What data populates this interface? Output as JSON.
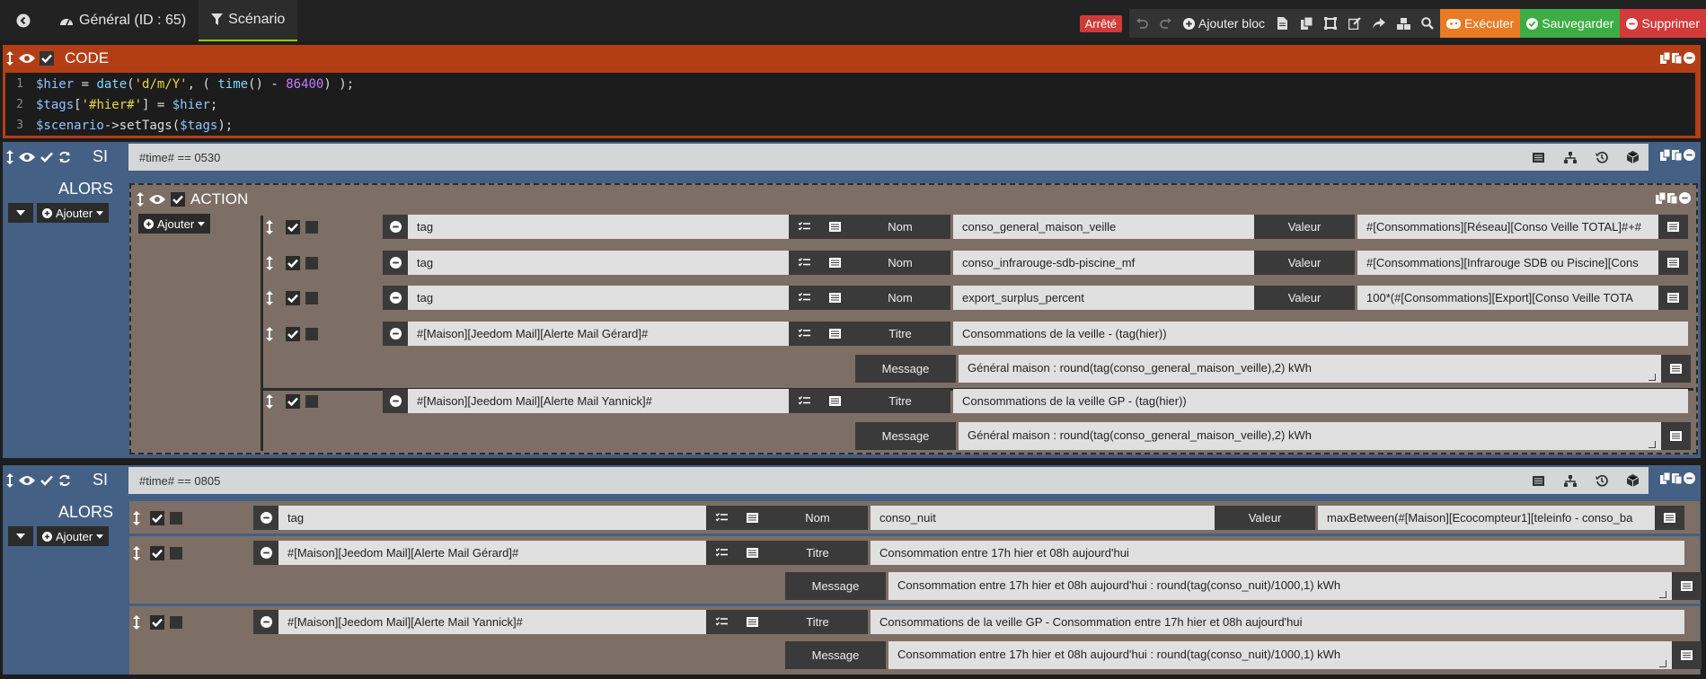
{
  "header": {
    "tabs": [
      {
        "label": "Général (ID : 65)"
      },
      {
        "label": "Scénario"
      }
    ],
    "status_badge": "Arrêté",
    "add_block_label": "Ajouter bloc",
    "execute_label": "Exécuter",
    "save_label": "Sauvegarder",
    "delete_label": "Supprimer",
    "colors": {
      "execute": "#e97b24",
      "save": "#3cad44",
      "delete": "#d33a3a",
      "status": "#d23a3a"
    }
  },
  "code_block": {
    "title": "CODE",
    "lines": [
      {
        "number": "1"
      },
      {
        "number": "2"
      },
      {
        "number": "3"
      }
    ],
    "line1": {
      "a": "$hier",
      "b": " = ",
      "c": "date",
      "d": "(",
      "e": "'d/m/Y'",
      "f": ", ( ",
      "g": "time",
      "h": "() - ",
      "i": "86400",
      "j": ") );"
    },
    "line2": {
      "a": "$tags",
      "b": "[",
      "c": "'#hier#'",
      "d": "] = ",
      "e": "$hier",
      "f": ";"
    },
    "line3": {
      "a": "$scenario",
      "b": "->setTags(",
      "c": "$tags",
      "d": ");"
    }
  },
  "si_block_1": {
    "label": "SI",
    "condition": "#time# == 0530",
    "alors_label": "ALORS",
    "add_label": "Ajouter",
    "action_title": "ACTION",
    "action_add_label": "Ajouter",
    "actions": [
      {
        "cmd": "tag",
        "k1": "Nom",
        "v1": "conso_general_maison_veille",
        "k2": "Valeur",
        "v2": "#[Consommations][Réseau][Conso Veille TOTAL]#+#"
      },
      {
        "cmd": "tag",
        "k1": "Nom",
        "v1": "conso_infrarouge-sdb-piscine_mf",
        "k2": "Valeur",
        "v2": "#[Consommations][Infrarouge SDB ou Piscine][Cons"
      },
      {
        "cmd": "tag",
        "k1": "Nom",
        "v1": "export_surplus_percent",
        "k2": "Valeur",
        "v2": "100*(#[Consommations][Export][Conso Veille TOTA"
      },
      {
        "cmd": "#[Maison][Jeedom Mail][Alerte Mail Gérard]#",
        "k1": "Titre",
        "v1": "Consommations de la veille - (tag(hier))",
        "k2": "Message",
        "v2": "Général maison : round(tag(conso_general_maison_veille),2) kWh"
      },
      {
        "cmd": "#[Maison][Jeedom Mail][Alerte Mail Yannick]#",
        "k1": "Titre",
        "v1": "Consommations de la veille GP - (tag(hier))",
        "k2": "Message",
        "v2": "Général maison : round(tag(conso_general_maison_veille),2) kWh"
      }
    ]
  },
  "si_block_2": {
    "label": "SI",
    "condition": "#time# == 0805",
    "alors_label": "ALORS",
    "add_label": "Ajouter",
    "actions": [
      {
        "cmd": "tag",
        "k1": "Nom",
        "v1": "conso_nuit",
        "k2": "Valeur",
        "v2": "maxBetween(#[Maison][Ecocompteur1][teleinfo - conso_ba"
      },
      {
        "cmd": "#[Maison][Jeedom Mail][Alerte Mail Gérard]#",
        "k1": "Titre",
        "v1": "Consommation entre 17h hier et 08h aujourd'hui",
        "k2": "Message",
        "v2": "Consommation entre 17h hier et 08h aujourd'hui : round(tag(conso_nuit)/1000,1) kWh"
      },
      {
        "cmd": "#[Maison][Jeedom Mail][Alerte Mail Yannick]#",
        "k1": "Titre",
        "v1": "Consommations de la veille GP - Consommation entre 17h hier et 08h aujourd'hui",
        "k2": "Message",
        "v2": "Consommation entre 17h hier et 08h aujourd'hui : round(tag(conso_nuit)/1000,1) kWh"
      }
    ]
  },
  "icons": [
    "arrow-left-icon",
    "dashboard-icon",
    "filter-icon",
    "undo-icon",
    "redo-icon",
    "plus-circle-icon",
    "file-icon",
    "copy-icon",
    "expand-icon",
    "edit-icon",
    "share-icon",
    "cubes-icon",
    "search-icon",
    "gamepad-icon",
    "check-circle-icon",
    "minus-circle-icon",
    "eye-icon",
    "checkbox-icon",
    "refresh-icon",
    "sort-icon",
    "list-icon",
    "history-icon",
    "cube-icon",
    "caret-down-icon"
  ]
}
